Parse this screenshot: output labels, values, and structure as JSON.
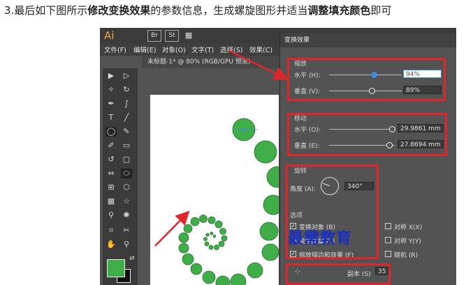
{
  "instruction": {
    "part1": "3.最后如下图所示",
    "bold1": "修改变换效果",
    "part2": "的参数信息，生成螺旋图形并适当",
    "bold2": "调整填充颜色",
    "part3": "即可"
  },
  "app": {
    "logo": "Ai",
    "br": "Br",
    "st": "St",
    "menu": [
      "文件(F)",
      "编辑(E)",
      "对象(O)",
      "文字(T)",
      "选择(S)",
      "效果(C)"
    ],
    "doc_tab": "未标题-1* @ 80% (RGB/GPU 预览)"
  },
  "dialog": {
    "title": "变换效果",
    "scale": {
      "section": "缩放",
      "h_label": "水平 (H):",
      "h_value": "94%",
      "h_fraction": 0.62,
      "v_label": "垂直 (V):",
      "v_value": "89%",
      "v_fraction": 0.59
    },
    "move": {
      "section": "移动",
      "h_label": "水平 (O):",
      "h_value": "29.9861 mm",
      "v_label": "垂直 (E):",
      "v_value": "27.8694 mm"
    },
    "rotate": {
      "section": "旋转",
      "angle_label": "角度 (A):",
      "angle_value": "340°"
    },
    "options": {
      "section": "选项",
      "items": [
        {
          "label": "变换对象 (B)",
          "checked": true
        },
        {
          "label": "变换图案 (T)",
          "checked": false
        },
        {
          "label": "缩放描边和效果 (F)",
          "checked": true
        }
      ],
      "right_items": [
        {
          "label": "对称 X(X)",
          "checked": false
        },
        {
          "label": "对称 Y(Y)",
          "checked": false
        },
        {
          "label": "随机 (R)",
          "checked": false
        }
      ]
    },
    "copies_label": "副本 (S)",
    "copies_value": "35"
  },
  "watermark": "最需教育",
  "colors": {
    "fill": "#3fae49",
    "highlight": "#e0262d",
    "accent": "#3d8ee0"
  }
}
